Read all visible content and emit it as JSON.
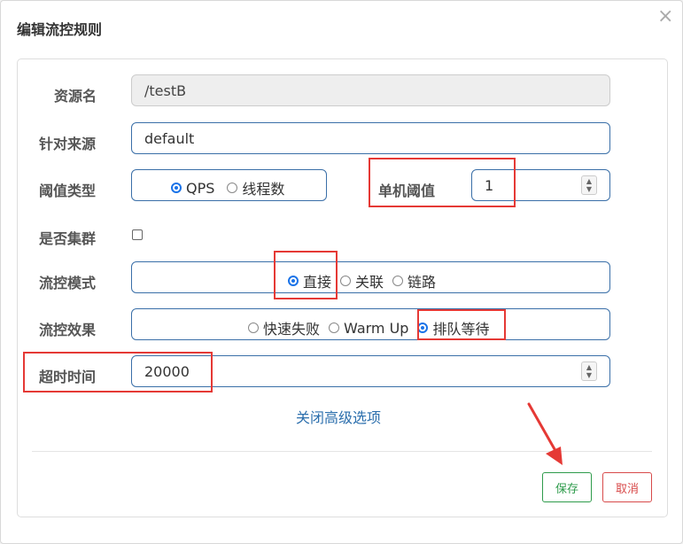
{
  "dialog": {
    "title": "编辑流控规则",
    "close_icon": "×"
  },
  "form": {
    "resource": {
      "label": "资源名",
      "value": "/testB"
    },
    "limit_app": {
      "label": "针对来源",
      "value": "default"
    },
    "threshold_type": {
      "label": "阈值类型",
      "options": [
        {
          "label": "QPS",
          "selected": true
        },
        {
          "label": "线程数",
          "selected": false
        }
      ]
    },
    "single_threshold": {
      "label": "单机阈值",
      "value": "1"
    },
    "cluster": {
      "label": "是否集群",
      "checked": false
    },
    "flow_mode": {
      "label": "流控模式",
      "options": [
        {
          "label": "直接",
          "selected": true
        },
        {
          "label": "关联",
          "selected": false
        },
        {
          "label": "链路",
          "selected": false
        }
      ]
    },
    "flow_effect": {
      "label": "流控效果",
      "options": [
        {
          "label": "快速失败",
          "selected": false
        },
        {
          "label": "Warm Up",
          "selected": false
        },
        {
          "label": "排队等待",
          "selected": true
        }
      ]
    },
    "timeout": {
      "label": "超时时间",
      "value": "20000"
    },
    "advanced_link": "关闭高级选项"
  },
  "footer": {
    "save_label": "保存",
    "cancel_label": "取消"
  },
  "colors": {
    "accent": "#1a73e8",
    "annotation_red": "#e53935",
    "save_green": "#2e9b4b",
    "cancel_red": "#d84a4a"
  }
}
